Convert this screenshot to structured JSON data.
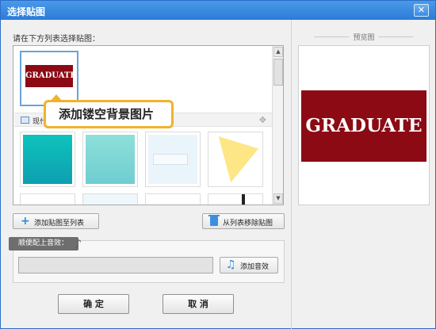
{
  "window": {
    "title": "选择贴图",
    "close_glyph": "✕"
  },
  "list": {
    "label": "请在下方列表选择贴图：",
    "selected_logo_text": "GRADUATE",
    "section_title": "现代",
    "tooltip": "添加镂空背景图片",
    "tile_colors": {
      "accent": "#8b0a14",
      "teal": "#12b3b0",
      "mint": "#84d7d2",
      "yellow": "#fde685"
    }
  },
  "buttons": {
    "add_to_list": "添加贴图至列表",
    "remove_from_list": "从列表移除贴图",
    "add_sound": "添加音效",
    "ok": "确 定",
    "cancel": "取 消"
  },
  "sound": {
    "tag": "顺便配上音效：",
    "value": ""
  },
  "preview": {
    "label": "预览图",
    "logo_text": "GRADUATE"
  },
  "icons": {
    "close": "close-icon",
    "image": "image-icon",
    "move": "move-icon",
    "plus": "plus-icon",
    "trash": "trash-icon",
    "note": "music-note-icon",
    "add_music": "add-music-icon"
  }
}
